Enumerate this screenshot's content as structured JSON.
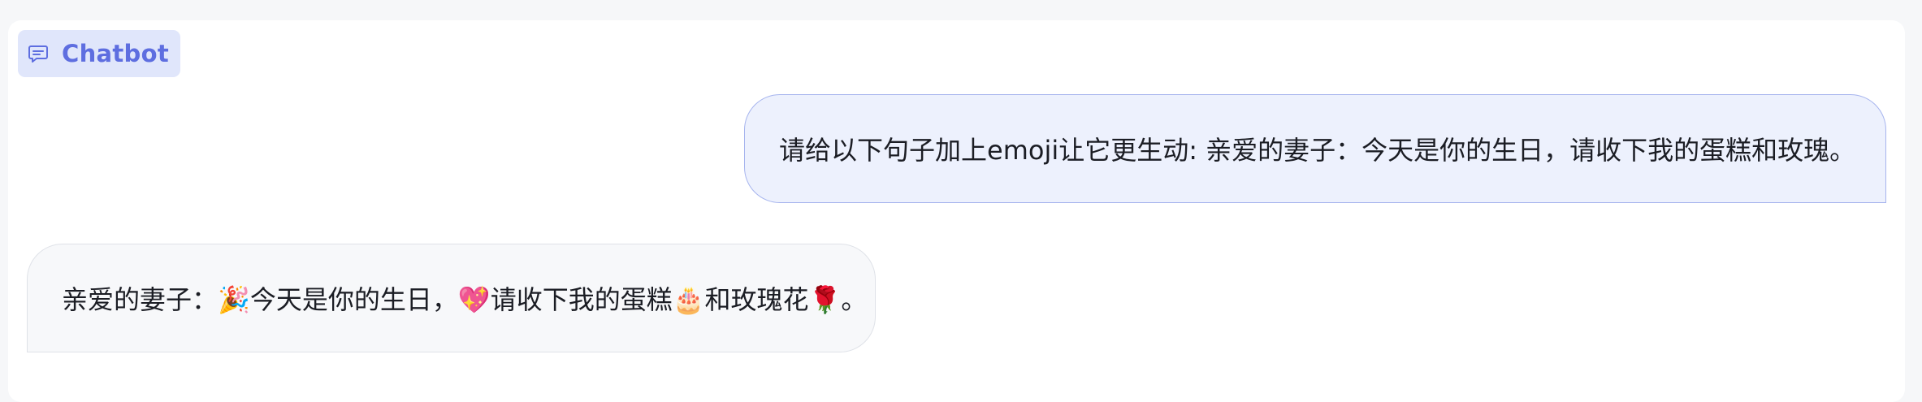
{
  "header": {
    "tag_label": "Chatbot",
    "tag_icon": "chat-bubble-icon",
    "accent_color": "#5e6ee0",
    "tag_bg_color": "#e0e6fb"
  },
  "messages": [
    {
      "role": "user",
      "text": "请给以下句子加上emoji让它更生动: 亲爱的妻子：今天是你的生日，请收下我的蛋糕和玫瑰。"
    },
    {
      "role": "bot",
      "text": "亲爱的妻子：🎉今天是你的生日，💖请收下我的蛋糕🎂和玫瑰花🌹。"
    }
  ]
}
